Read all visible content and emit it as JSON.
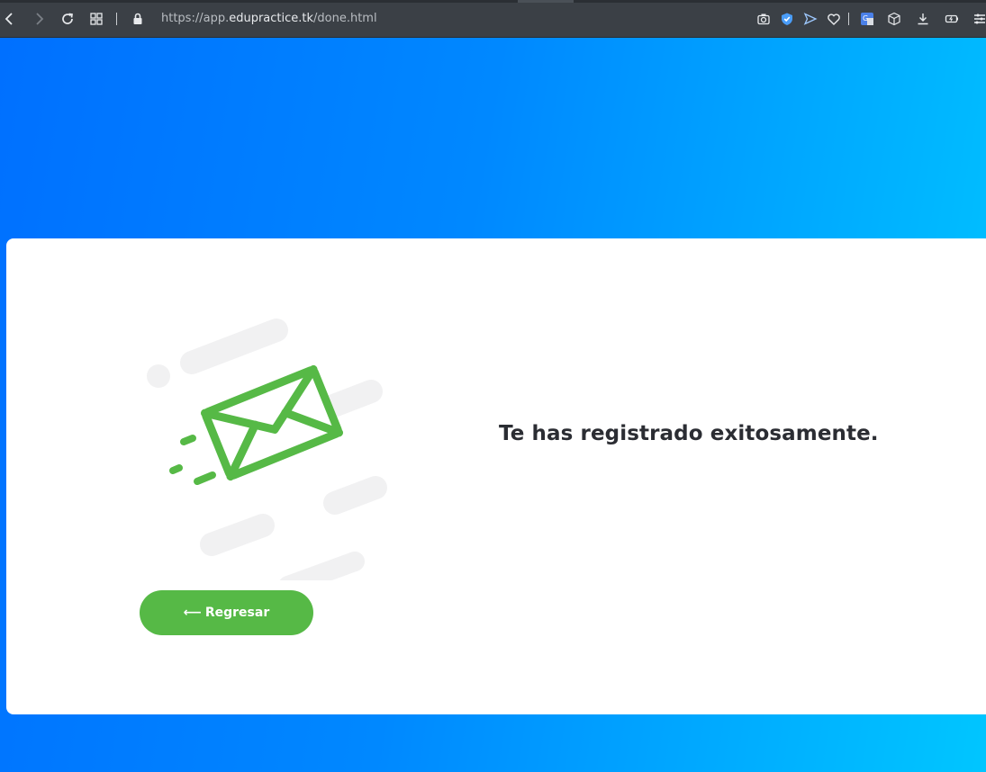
{
  "browser": {
    "url_prefix": "https://app.",
    "url_host": "edupractice.tk",
    "url_path": "/done.html"
  },
  "card": {
    "message": "Te has registrado exitosamente.",
    "back_button_arrow": "⟵",
    "back_button_label": "Regresar"
  },
  "colors": {
    "accent_green": "#56b946",
    "gradient_start": "#0070ff",
    "gradient_end": "#00c6ff"
  }
}
